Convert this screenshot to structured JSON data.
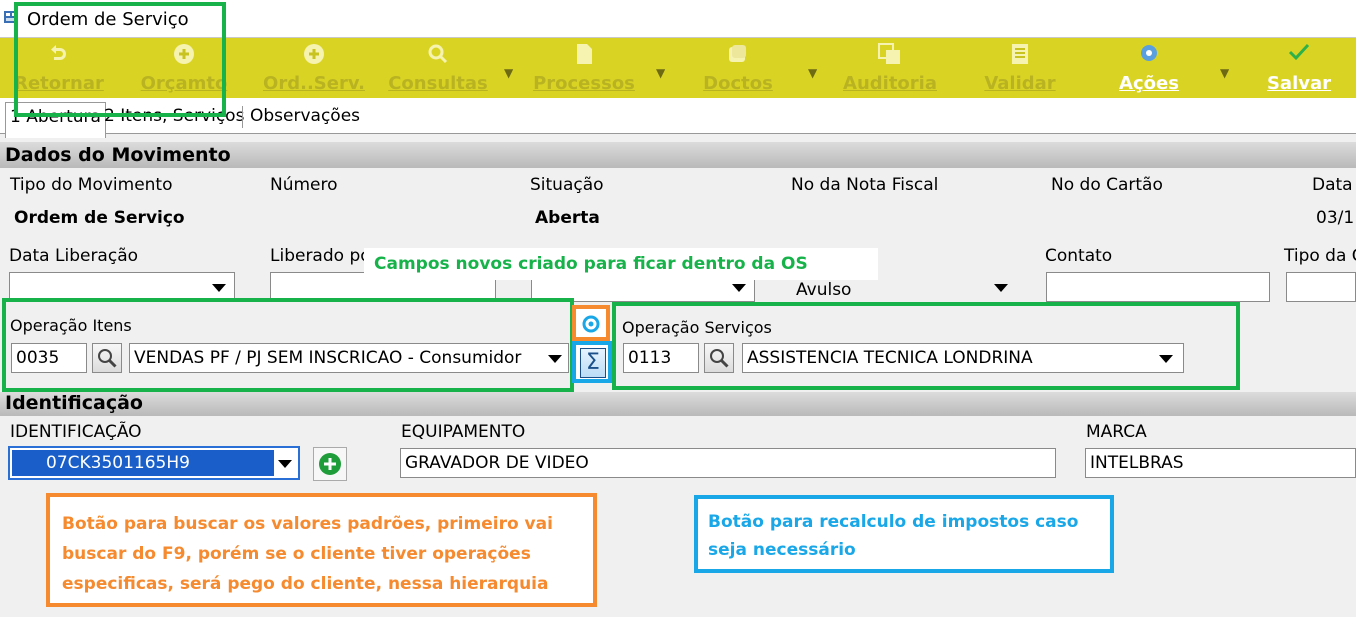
{
  "window": {
    "title": "Ordem de Serviço"
  },
  "toolbar": {
    "buttons": [
      {
        "label": "Retornar",
        "icon": "return-icon"
      },
      {
        "label": "Orçamto",
        "icon": "add-icon"
      },
      {
        "label": "Ord..Serv.",
        "icon": "add-icon"
      },
      {
        "label": "Consultas",
        "icon": "search-icon"
      },
      {
        "label": "Processos",
        "icon": "document-icon"
      },
      {
        "label": "Doctos",
        "icon": "documents-icon"
      },
      {
        "label": "Auditoria",
        "icon": "audit-icon"
      },
      {
        "label": "Validar",
        "icon": "checklist-icon"
      },
      {
        "label": "Ações",
        "icon": "gear-icon"
      },
      {
        "label": "Salvar",
        "icon": "check-icon"
      }
    ]
  },
  "tabs": [
    "1 Abertura",
    "2 Itens, Serviços",
    "Observações"
  ],
  "movimento": {
    "heading": "Dados do Movimento",
    "tipo_label": "Tipo do Movimento",
    "tipo_value": "Ordem de Serviço",
    "numero_label": "Número",
    "situacao_label": "Situação",
    "situacao_value": "Aberta",
    "nota_label": "No da Nota Fiscal",
    "cartao_label": "No do Cartão",
    "data_label": "Data",
    "data_value": "03/1",
    "liberacao_label": "Data Liberação",
    "liberado_label": "Liberado po",
    "avulso_value": "Avulso",
    "contato_label": "Contato",
    "tipo_da_label": "Tipo da C"
  },
  "operacao_itens": {
    "label": "Operação Itens",
    "code": "0035",
    "description": "VENDAS PF / PJ SEM INSCRICAO - Consumidor"
  },
  "operacao_servicos": {
    "label": "Operação Serviços",
    "code": "0113",
    "description": "ASSISTENCIA TECNICA LONDRINA"
  },
  "identificacao": {
    "heading": "Identificação",
    "id_label": "IDENTIFICAÇÃO",
    "id_value": "07CK3501165H9",
    "equip_label": "EQUIPAMENTO",
    "equip_value": "GRAVADOR DE VIDEO",
    "marca_label": "MARCA",
    "marca_value": "INTELBRAS"
  },
  "annotations": {
    "green": "Campos novos criado para ficar dentro da OS",
    "orange_lines": [
      "Botão para buscar os valores padrões, primeiro vai",
      "buscar do F9, porém se o cliente tiver operações",
      "especificas, será pego do cliente, nessa hierarquia"
    ],
    "blue_lines": [
      "Botão para recalculo de impostos caso",
      "seja necessário"
    ]
  },
  "colors": {
    "toolbar": "#d9d424",
    "green": "#17b34a",
    "orange": "#f58a2f",
    "blue": "#1aa7e8"
  }
}
